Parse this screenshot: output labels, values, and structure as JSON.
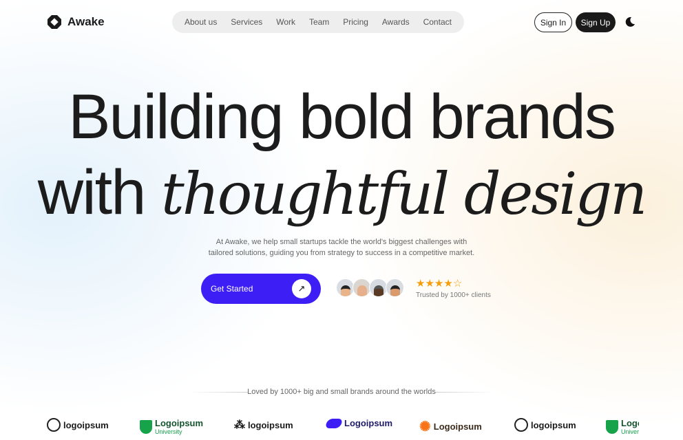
{
  "nav": {
    "brand": "Awake",
    "items": [
      "About us",
      "Services",
      "Work",
      "Team",
      "Pricing",
      "Awards",
      "Contact"
    ],
    "sign_in": "Sign In",
    "sign_up": "Sign Up",
    "theme_icon": "moon-icon"
  },
  "hero": {
    "line1": "Building bold brands",
    "line2_plain": "with",
    "line2_italic": "thoughtful design",
    "subtitle": "At Awake, we help small startups tackle the world's biggest challenges with tailored solutions, guiding you from strategy to success in a competitive market.",
    "cta": "Get Started",
    "rating": 4,
    "rating_max": 5,
    "trust": "Trusted by 1000+ clients"
  },
  "brands": {
    "caption": "Loved by 1000+ big and small brands around the worlds",
    "logos": [
      {
        "name": "logoipsum"
      },
      {
        "name": "Logoipsum",
        "sub": "University"
      },
      {
        "name": "logoipsum"
      },
      {
        "name": "Logoipsum"
      },
      {
        "name": "Logoipsum"
      },
      {
        "name": "logoipsum"
      },
      {
        "name": "Logoipsum",
        "sub": "University"
      }
    ]
  },
  "colors": {
    "accent": "#3d1ff5",
    "star": "#f59e0b",
    "green": "#16a34a"
  }
}
